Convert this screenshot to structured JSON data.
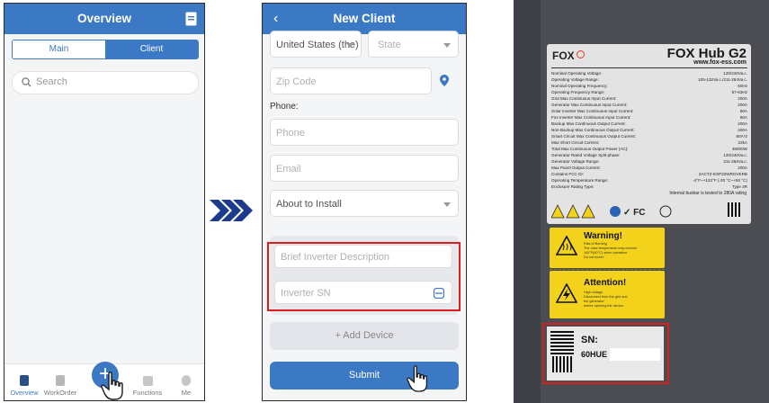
{
  "screen1": {
    "title": "Overview",
    "tabs": [
      "Main",
      "Client"
    ],
    "search_placeholder": "Search",
    "nav": [
      "Overview",
      "WorkOrder",
      "Functions",
      "Me"
    ]
  },
  "screen2": {
    "title": "New Client",
    "country": "United States (the)",
    "state_placeholder": "State",
    "zip_placeholder": "Zip Code",
    "phone_label": "Phone:",
    "phone_placeholder": "Phone",
    "email_placeholder": "Email",
    "status_value": "About to Install",
    "inverter_desc_placeholder": "Brief Inverter Description",
    "inverter_sn_placeholder": "Inverter SN",
    "add_device_label": "+ Add Device",
    "submit_label": "Submit"
  },
  "nameplate": {
    "brand": "FOX",
    "product": "FOX Hub G2",
    "website": "www.fox-ess.com",
    "specs": [
      [
        "Nominal Operating Voltage:",
        "120/240Va.c."
      ],
      [
        "Operating Voltage Range:",
        "105-132Va.c./211-264Va.c."
      ],
      [
        "Nominal Operating Frequency:",
        "60Hz"
      ],
      [
        "Operating Frequency Range:",
        "57-63Hz"
      ],
      [
        "Grid Max Continuous Input Current:",
        "200A"
      ],
      [
        "Generator Max Continuous Input Current:",
        "200A"
      ],
      [
        "Solar Inverter Max Continuous Input Current:",
        "80A"
      ],
      [
        "Fox Inverter Max Continuous Input Current:",
        "80A"
      ],
      [
        "Backup Max Continuous Output Current:",
        "200A"
      ],
      [
        "Non-Backup Max Continuous Output Current:",
        "200A"
      ],
      [
        "Smart Circuit Max Continuous Output Current:",
        "80A*2"
      ],
      [
        "Max Short Circuit Current:",
        "22kA"
      ],
      [
        "Total Max Continuous Output Power (AC):",
        "48000W"
      ],
      [
        "Generator Rated Voltage Split-phase:",
        "120/240Va.c."
      ],
      [
        "Generator Voltage Range:",
        "211-264Va.c."
      ],
      [
        "Max Panel Output Current:",
        "200A"
      ],
      [
        "Contains FCC ID:",
        "2ACTZ-ESP32WROVERB"
      ],
      [
        "Operating Temperature Range:",
        "-4°F~+122°F (-20 °C~+50 °C)"
      ],
      [
        "Enclosure Rating Type:",
        "Type 3R"
      ]
    ],
    "busbar_note": "Internal busbar is tested to 280A rating"
  },
  "warnings": [
    {
      "title": "Warning!",
      "lines": [
        "Risk of Burning",
        "The case temperature may exceed",
        "140°F(60°C) when operation.",
        "Do not touch!"
      ]
    },
    {
      "title": "Attention!",
      "lines": [
        "High voltage.",
        "Disconnect from the grid and",
        "the generator",
        "before opening the device."
      ]
    }
  ],
  "sn_label": {
    "title": "SN:",
    "value": "60HUE"
  }
}
